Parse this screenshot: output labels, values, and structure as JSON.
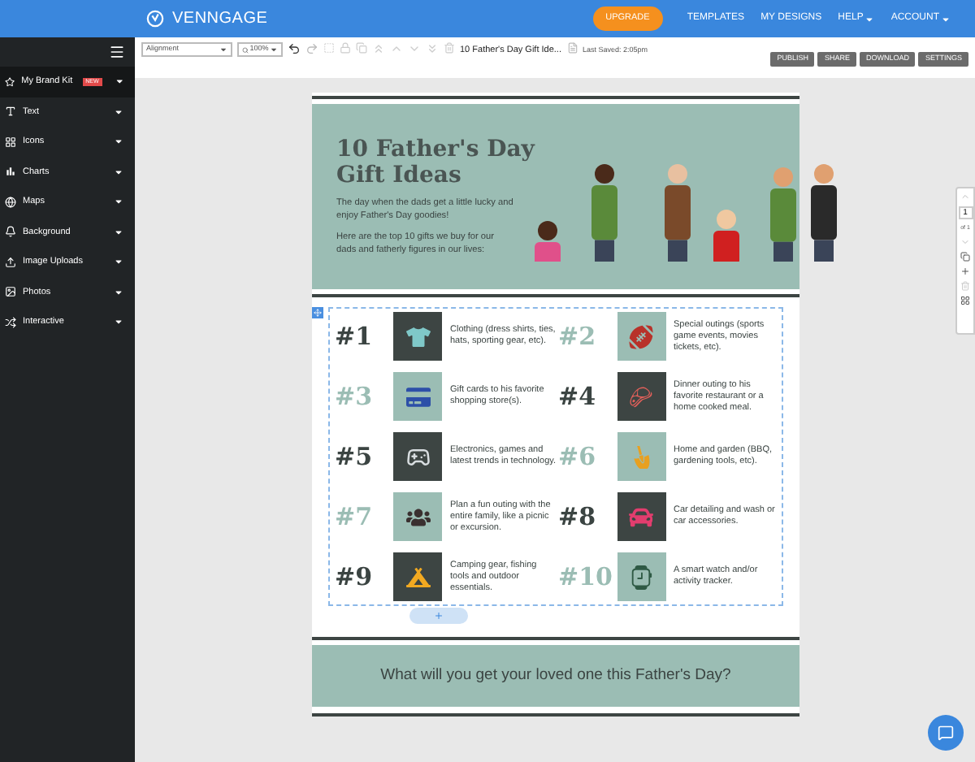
{
  "top_bar": {
    "logo": "VENNGAGE",
    "upgrade": "UPGRADE",
    "nav": [
      {
        "label": "TEMPLATES",
        "dropdown": false
      },
      {
        "label": "MY DESIGNS",
        "dropdown": false
      },
      {
        "label": "HELP",
        "dropdown": true
      },
      {
        "label": "ACCOUNT",
        "dropdown": true
      }
    ]
  },
  "sidebar": {
    "items": [
      {
        "label": "My Brand Kit",
        "badge": "NEW",
        "selected": true
      },
      {
        "label": "Text",
        "selected": false
      },
      {
        "label": "Icons",
        "selected": false
      },
      {
        "label": "Charts",
        "selected": false
      },
      {
        "label": "Maps",
        "selected": false
      },
      {
        "label": "Background",
        "selected": false
      },
      {
        "label": "Image Uploads",
        "selected": false
      },
      {
        "label": "Photos",
        "selected": false
      },
      {
        "label": "Interactive",
        "selected": false
      }
    ]
  },
  "toolbar": {
    "alignment": "Alignment",
    "zoom": "100%",
    "document_title": "10 Father's Day Gift Ide...",
    "last_saved": "Last Saved: 2:05pm",
    "buttons": [
      "PUBLISH",
      "SHARE",
      "DOWNLOAD",
      "SETTINGS"
    ]
  },
  "header": {
    "title": "10 Father's Day Gift Ideas",
    "paragraphs": [
      "The day when the dads get a little lucky and enjoy Father's Day goodies!",
      "Here are the top 10 gifts we buy for our dads and fatherly figures in our lives:"
    ]
  },
  "gifts": [
    {
      "number": "#1",
      "text": "Clothing (dress shirts, ties, hats, sporting gear, etc).",
      "kind": "dark"
    },
    {
      "number": "#2",
      "text": "Special outings (sports game events, movies tickets, etc).",
      "kind": "light"
    },
    {
      "number": "#3",
      "text": "Gift cards to his favorite shopping store(s).",
      "kind": "light"
    },
    {
      "number": "#4",
      "text": "Dinner outing to his favorite restaurant or a home cooked meal.",
      "kind": "dark"
    },
    {
      "number": "#5",
      "text": "Electronics, games and latest trends in technology.",
      "kind": "dark"
    },
    {
      "number": "#6",
      "text": "Home and garden (BBQ, gardening tools, etc).",
      "kind": "light"
    },
    {
      "number": "#7",
      "text": "Plan a fun outing with the entire family, like a picnic or excursion.",
      "kind": "light"
    },
    {
      "number": "#8",
      "text": "Car detailing and wash or car accessories.",
      "kind": "dark"
    },
    {
      "number": "#9",
      "text": "Camping gear, fishing tools and outdoor essentials.",
      "kind": "dark"
    },
    {
      "number": "#10",
      "text": "A smart watch and/or activity tracker.",
      "kind": "light"
    }
  ],
  "footer_banner": "What will you get your loved one this Father's Day?",
  "page_nav": {
    "page": "1",
    "total": "of 1"
  }
}
